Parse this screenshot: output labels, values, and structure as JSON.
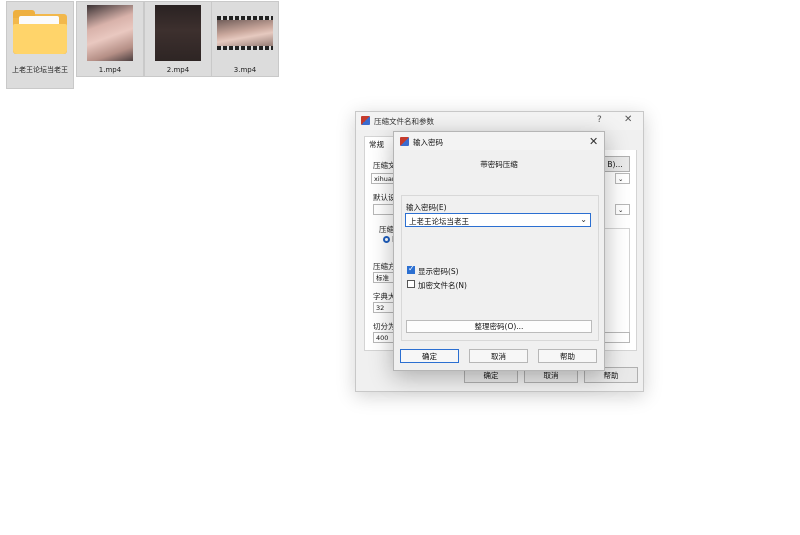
{
  "desktop": {
    "files": [
      {
        "name": "上老王论坛当老王",
        "type": "folder"
      },
      {
        "name": "1.mp4",
        "type": "video"
      },
      {
        "name": "2.mp4",
        "type": "video"
      },
      {
        "name": "3.mp4",
        "type": "video"
      }
    ]
  },
  "back_dialog": {
    "title": "压缩文件名和参数",
    "help_glyph": "?",
    "close_glyph": "✕",
    "tab_general": "常规",
    "archive_name_label": "压缩文",
    "archive_name_value": "xihuan",
    "browse_button": "B)...",
    "profile_label": "默认设",
    "format_label": "压缩",
    "format_radio": "R",
    "method_label": "压缩方",
    "method_value": "标准",
    "dict_label": "字典大",
    "dict_value": "32",
    "split_label": "切分为",
    "split_value": "400",
    "ok": "确定",
    "cancel": "取消",
    "help": "帮助"
  },
  "password_dialog": {
    "title": "输入密码",
    "close_glyph": "✕",
    "header": "带密码压缩",
    "password_label": "输入密码(E)",
    "password_value": "上老王论坛当老王",
    "show_password": {
      "label": "显示密码(S)",
      "checked": true
    },
    "encrypt_names": {
      "label": "加密文件名(N)",
      "checked": false
    },
    "organize_button": "整理密码(O)...",
    "ok": "确定",
    "cancel": "取消",
    "help": "帮助"
  }
}
